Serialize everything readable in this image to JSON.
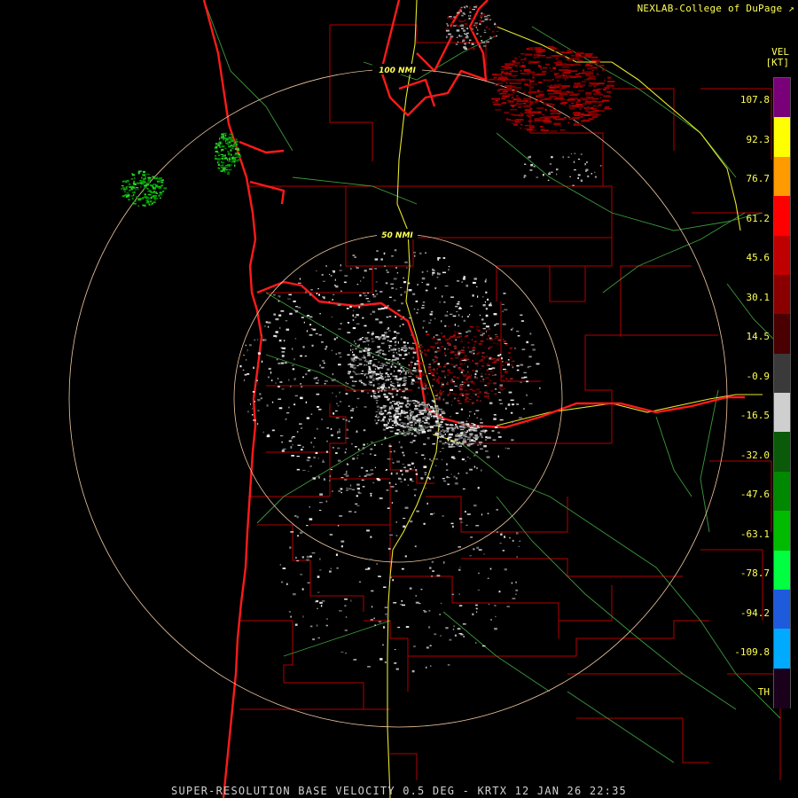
{
  "credit": "NEXLAB-College of DuPage ↗",
  "product_label": "VEL",
  "units_label": "[KT]",
  "legend": {
    "ticks": [
      "107.8",
      "92.3",
      "76.7",
      "61.2",
      "45.6",
      "30.1",
      "14.5",
      "-0.9",
      "-16.5",
      "-32.0",
      "-47.6",
      "-63.1",
      "-78.7",
      "-94.2",
      "-109.8",
      "TH"
    ],
    "colors": [
      "#7a007a",
      "#ffff00",
      "#ff9a00",
      "#ff0000",
      "#c00000",
      "#8a0000",
      "#4a0000",
      "#3a3a3a",
      "#cfcfcf",
      "#0a5a0a",
      "#008800",
      "#00bb00",
      "#00ff40",
      "#1e5adc",
      "#00aaff",
      "#1a001a"
    ]
  },
  "range_rings": [
    "50 NMI",
    "100 NMI"
  ],
  "footer": "SUPER-RESOLUTION BASE VELOCITY 0.5 DEG - KRTX 12 JAN 26 22:35"
}
